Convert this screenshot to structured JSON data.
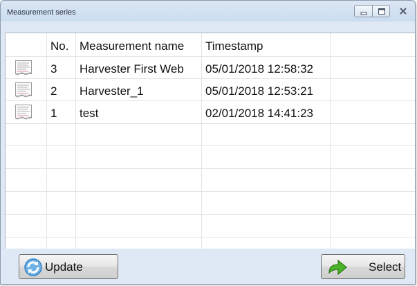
{
  "window": {
    "title": "Measurement series"
  },
  "table": {
    "columns": [
      "No.",
      "Measurement name",
      "Timestamp"
    ],
    "rows": [
      {
        "no": "3",
        "name": "Harvester First Web",
        "timestamp": "05/01/2018 12:58:32",
        "icon": "document-icon"
      },
      {
        "no": "2",
        "name": "Harvester_1",
        "timestamp": "05/01/2018 12:53:21",
        "icon": "document-icon"
      },
      {
        "no": "1",
        "name": "test",
        "timestamp": "02/01/2018 14:41:23",
        "icon": "document-icon"
      }
    ]
  },
  "buttons": {
    "update_label": "Update",
    "update_icon": "refresh-icon",
    "select_label": "Select",
    "select_icon": "arrow-right-icon"
  },
  "colors": {
    "window_bg": "#dfe9f5",
    "grid_line": "#e6e6e6",
    "select_arrow": "#3a9a1f",
    "refresh_icon": "#2f7fc4"
  }
}
